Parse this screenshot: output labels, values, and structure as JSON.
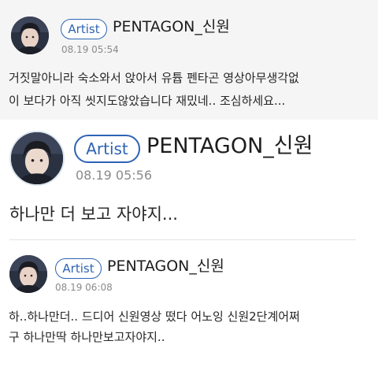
{
  "posts": [
    {
      "badge": "Artist",
      "author": "PENTAGON_신원",
      "time": "08.19 05:54",
      "lines": [
        "거짓말아니라 숙소와서 앉아서 유튭 펜타곤 영상아무생각없",
        "이 보다가 아직 씻지도않았습니다 재밌네.. 조심하세요..."
      ],
      "avatar_icon": "profile-photo"
    },
    {
      "badge": "Artist",
      "author": "PENTAGON_신원",
      "time": "08.19 05:56",
      "lines": [
        "하나만 더 보고 자야지..."
      ],
      "avatar_icon": "profile-photo"
    },
    {
      "badge": "Artist",
      "author": "PENTAGON_신원",
      "time": "08.19 06:08",
      "lines": [
        "하..하나만더.. 드디어 신원영상 떴다 어노잉 신원2단계어쩌",
        "구 하나만딱 하나만보고자야지.."
      ],
      "avatar_icon": "profile-photo"
    }
  ],
  "colors": {
    "badge_blue": "#2d63b4",
    "post_bg_gray": "#f5f5f6",
    "timestamp_gray": "#8a8a8a"
  }
}
